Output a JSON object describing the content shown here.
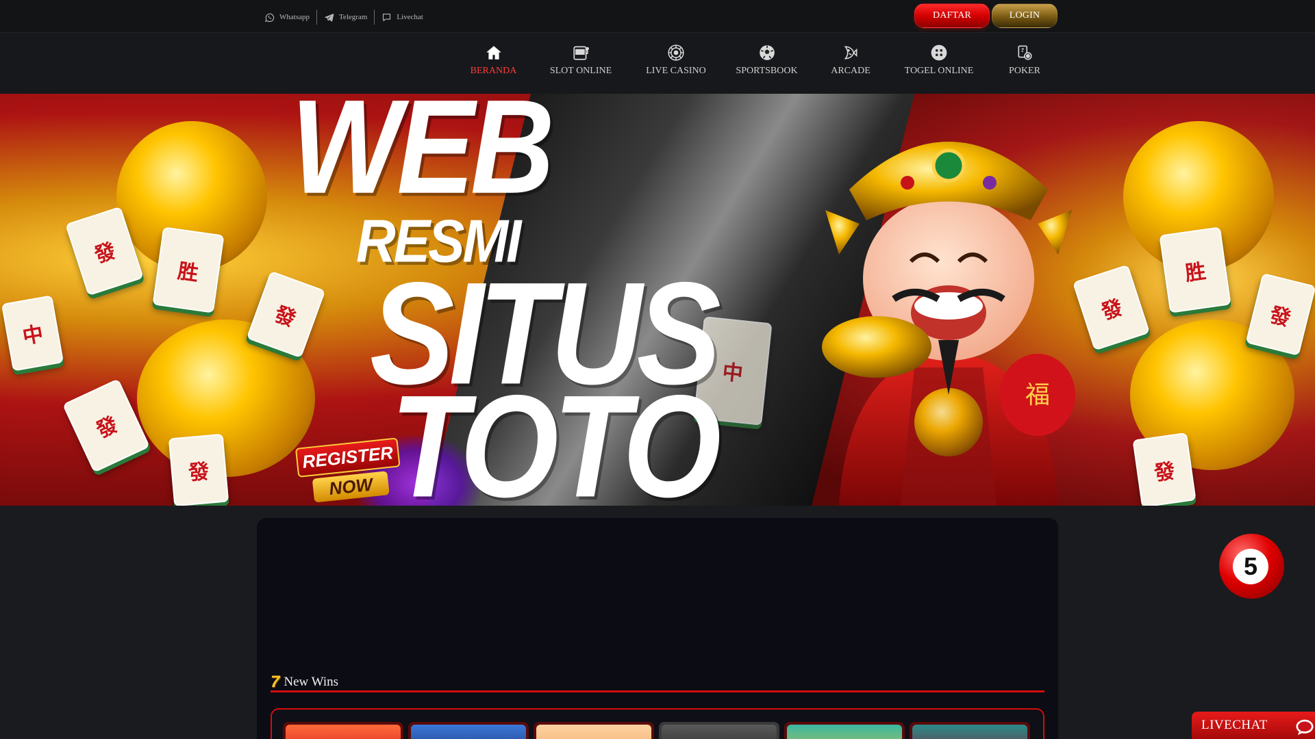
{
  "topbar": {
    "contacts": [
      {
        "label": "Whatsapp",
        "icon": "whatsapp-icon"
      },
      {
        "label": "Telegram",
        "icon": "telegram-icon"
      },
      {
        "label": "Livechat",
        "icon": "chat-bubble-icon"
      }
    ],
    "daftar_label": "DAFTAR",
    "login_label": "LOGIN"
  },
  "nav": {
    "items": [
      {
        "label": "BERANDA",
        "icon": "home-icon",
        "active": true
      },
      {
        "label": "SLOT ONLINE",
        "icon": "slot-machine-icon"
      },
      {
        "label": "LIVE CASINO",
        "icon": "roulette-icon"
      },
      {
        "label": "SPORTSBOOK",
        "icon": "soccer-ball-icon"
      },
      {
        "label": "ARCADE",
        "icon": "fish-icon"
      },
      {
        "label": "TOGEL ONLINE",
        "icon": "dice-icon"
      },
      {
        "label": "POKER",
        "icon": "poker-cards-icon"
      }
    ],
    "active_color": "#ff3b3b"
  },
  "banner": {
    "line1": "WEB",
    "line2": "RESMI",
    "line3": "SITUS",
    "line4": "TOTO",
    "register_line1": "REGISTER",
    "register_line2": "NOW",
    "ball_number": "5"
  },
  "wins": {
    "title": "New Wins",
    "icon_char": "7"
  },
  "livechat": {
    "label": "LIVECHAT"
  },
  "colors": {
    "accent_red": "#d40d0d",
    "gold": "#c8a04a",
    "background": "#1a1b1e"
  }
}
